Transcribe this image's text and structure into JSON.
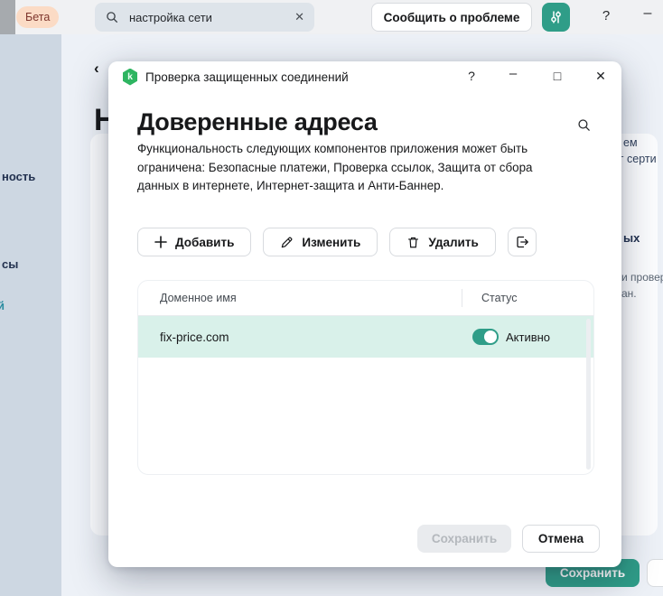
{
  "colors": {
    "accent_green": "#2F9D88",
    "row_highlight": "#D9F1EA",
    "logo_green": "#2EB561",
    "beta_bg": "#FBDBC5",
    "beta_text": "#7D352C"
  },
  "icons": {
    "search": "magnifier-glyph",
    "clear": "✕",
    "settings": "vertical-sliders",
    "add": "plus",
    "edit": "pencil",
    "delete": "trash",
    "export": "box-arrow-right"
  },
  "top_bar": {
    "beta_badge": "Бета",
    "search": {
      "value": "настройка сети",
      "clear_glyph": "✕"
    },
    "report_button": "Сообщить о проблеме",
    "help": "?",
    "minimize": "–"
  },
  "background_page": {
    "back_chevron": "‹",
    "heading_fragment": "Н",
    "sidebar_fragments": [
      "ность",
      "сы",
      "й"
    ],
    "right_fragments": [
      "ем",
      "г серти",
      "ых",
      "и провер",
      "ан."
    ],
    "save_button": "Сохранить"
  },
  "dialog": {
    "logo_letter": "k",
    "title": "Проверка защищенных соединений",
    "window_controls": {
      "help": "?",
      "minimize": "–",
      "maximize": "□",
      "close": "✕"
    },
    "heading": "Доверенные адреса",
    "description": "Функциональность следующих компонентов приложения может быть ограничена: Безопасные платежи, Проверка ссылок, Защита от сбора данных в интернете, Интернет-защита и Анти-Баннер.",
    "actions": [
      {
        "label": "Добавить",
        "icon": "plus-icon"
      },
      {
        "label": "Изменить",
        "icon": "pencil-icon"
      },
      {
        "label": "Удалить",
        "icon": "trash-icon"
      }
    ],
    "table": {
      "columns": [
        "Доменное имя",
        "Статус"
      ],
      "rows": [
        {
          "domain": "fix-price.com",
          "status": "Активно",
          "enabled": true
        }
      ]
    },
    "footer": {
      "save": "Сохранить",
      "cancel": "Отмена"
    }
  }
}
